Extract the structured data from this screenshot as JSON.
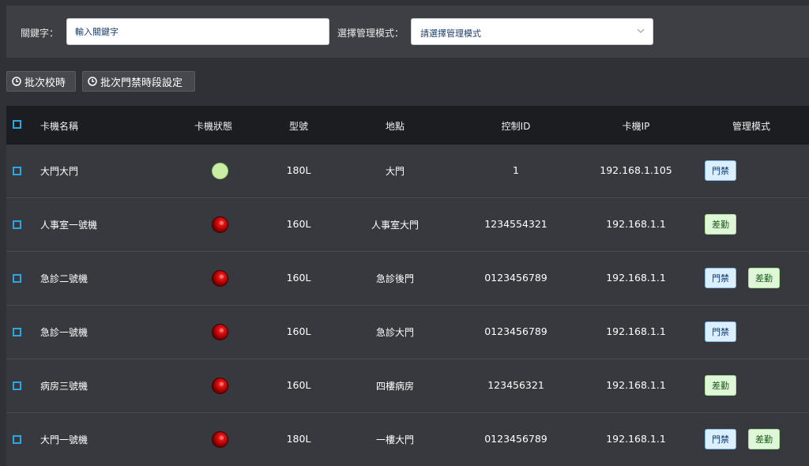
{
  "filter": {
    "keyword_label": "關鍵字：",
    "keyword_placeholder": "輸入關鍵字",
    "mode_label": "選擇管理模式：",
    "mode_selected": "請選擇管理模式"
  },
  "actions": {
    "batch_time_sync": "批次校時",
    "batch_access_period": "批次門禁時段設定"
  },
  "table": {
    "headers": {
      "name": "卡機名稱",
      "status": "卡機狀態",
      "model": "型號",
      "location": "地點",
      "control_id": "控制ID",
      "ip": "卡機IP",
      "mode": "管理模式"
    },
    "rows": [
      {
        "name": "大門大門",
        "status": "online",
        "model": "180L",
        "location": "大門",
        "control_id": "1",
        "ip": "192.168.1.105",
        "modes": [
          "門禁"
        ]
      },
      {
        "name": "人事室一號機",
        "status": "offline",
        "model": "160L",
        "location": "人事室大門",
        "control_id": "1234554321",
        "ip": "192.168.1.1",
        "modes": [
          "差勤"
        ]
      },
      {
        "name": "急診二號機",
        "status": "offline",
        "model": "160L",
        "location": "急診後門",
        "control_id": "0123456789",
        "ip": "192.168.1.1",
        "modes": [
          "門禁",
          "差勤"
        ]
      },
      {
        "name": "急診一號機",
        "status": "offline",
        "model": "160L",
        "location": "急診大門",
        "control_id": "0123456789",
        "ip": "192.168.1.1",
        "modes": [
          "門禁"
        ]
      },
      {
        "name": "病房三號機",
        "status": "offline",
        "model": "160L",
        "location": "四樓病房",
        "control_id": "123456321",
        "ip": "192.168.1.1",
        "modes": [
          "差勤"
        ]
      },
      {
        "name": "大門一號機",
        "status": "offline",
        "model": "180L",
        "location": "一樓大門",
        "control_id": "0123456789",
        "ip": "192.168.1.1",
        "modes": [
          "門禁",
          "差勤"
        ]
      }
    ]
  },
  "colors": {
    "checkbox": "#2da8df",
    "status_online": "#c9eea3",
    "status_offline": "#d41414",
    "badge_door": "#dcefff",
    "badge_attend": "#dff7d8"
  }
}
